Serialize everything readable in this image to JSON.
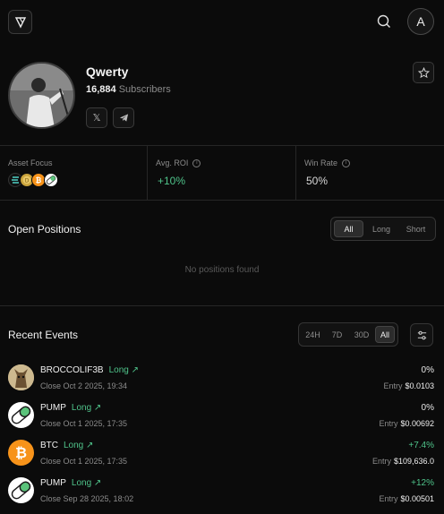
{
  "header": {
    "avatar_letter": "A"
  },
  "profile": {
    "name": "Qwerty",
    "subscribers_count": "16,884",
    "subscribers_label": "Subscribers",
    "socials": [
      {
        "icon": "x-icon",
        "glyph": "𝕏"
      },
      {
        "icon": "telegram-icon",
        "glyph": "➤"
      }
    ]
  },
  "stats": {
    "asset_focus_label": "Asset Focus",
    "avg_roi_label": "Avg. ROI",
    "avg_roi_value": "+10%",
    "win_rate_label": "Win Rate",
    "win_rate_value": "50%",
    "asset_icons": [
      "solana-coin-icon",
      "doge-coin-icon",
      "bitcoin-coin-icon",
      "pump-pill-icon"
    ]
  },
  "open_positions": {
    "title": "Open Positions",
    "tabs": [
      "All",
      "Long",
      "Short"
    ],
    "active_tab": "All",
    "empty_text": "No positions found"
  },
  "recent_events": {
    "title": "Recent Events",
    "tabs": [
      "24H",
      "7D",
      "30D",
      "All"
    ],
    "active_tab": "All",
    "entry_label": "Entry",
    "items": [
      {
        "token": "BROCCOLIF3B",
        "side": "Long ↗",
        "date": "Close Oct 2 2025, 19:34",
        "pct": "0%",
        "entry": "$0.0103",
        "icon": "broccoli-dog-icon",
        "positive": false
      },
      {
        "token": "PUMP",
        "side": "Long ↗",
        "date": "Close Oct 1 2025, 17:35",
        "pct": "0%",
        "entry": "$0.00692",
        "icon": "pump-pill-icon",
        "positive": false
      },
      {
        "token": "BTC",
        "side": "Long ↗",
        "date": "Close Oct 1 2025, 17:35",
        "pct": "+7.4%",
        "entry": "$109,636.0",
        "icon": "bitcoin-icon",
        "positive": true
      },
      {
        "token": "PUMP",
        "side": "Long ↗",
        "date": "Close Sep 28 2025, 18:02",
        "pct": "+12%",
        "entry": "$0.00501",
        "icon": "pump-pill-icon",
        "positive": true
      }
    ]
  },
  "colors": {
    "accent_green": "#4fc38a",
    "bitcoin_orange": "#f7931a",
    "background": "#0b0b0b"
  }
}
